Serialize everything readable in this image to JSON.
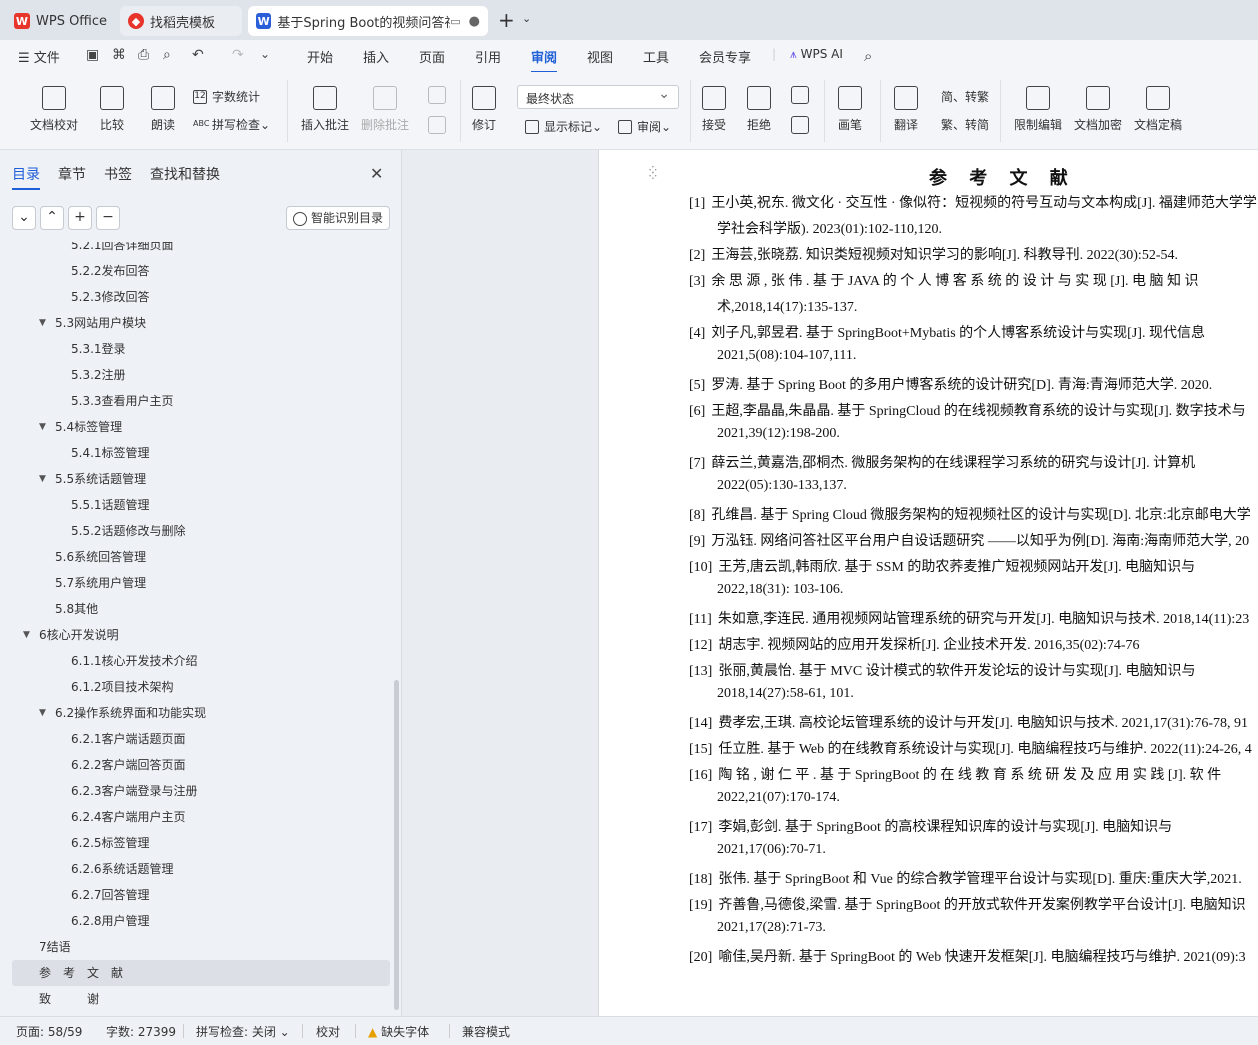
{
  "tabs": [
    {
      "label": "WPS Office",
      "icon": "wps-logo-icon"
    },
    {
      "label": "找稻壳模板",
      "icon": "docer-icon"
    },
    {
      "label": "基于Spring Boot的视频问答社",
      "icon": "word-doc-icon"
    }
  ],
  "menu": {
    "file": "文件",
    "items": [
      "开始",
      "插入",
      "页面",
      "引用",
      "审阅",
      "视图",
      "工具",
      "会员专享"
    ],
    "active": "审阅",
    "wps_ai": "WPS AI"
  },
  "ribbon": {
    "doc_proof": "文档校对",
    "compare": "比较",
    "read_aloud": "朗读",
    "word_count": "字数统计",
    "spell_check": "拼写检查",
    "insert_comment": "插入批注",
    "delete_comment": "删除批注",
    "revise": "修订",
    "status_value": "最终状态",
    "show_marks": "显示标记",
    "review": "审阅",
    "accept": "接受",
    "reject": "拒绝",
    "pen": "画笔",
    "translate": "翻译",
    "s2t": "简、转繁",
    "t2s": "繁、转简",
    "restrict_edit": "限制编辑",
    "doc_encrypt": "文档加密",
    "doc_finalize": "文档定稿"
  },
  "sidebar": {
    "tabs": [
      "目录",
      "章节",
      "书签",
      "查找和替换"
    ],
    "smart_toc": "智能识别目录",
    "items": [
      {
        "label": "5.2.1回答详细页面",
        "level": 3
      },
      {
        "label": "5.2.2发布回答",
        "level": 3
      },
      {
        "label": "5.2.3修改回答",
        "level": 3
      },
      {
        "label": "5.3网站用户模块",
        "level": 2,
        "arrow": true
      },
      {
        "label": "5.3.1登录",
        "level": 3
      },
      {
        "label": "5.3.2注册",
        "level": 3
      },
      {
        "label": "5.3.3查看用户主页",
        "level": 3
      },
      {
        "label": "5.4标签管理",
        "level": 2,
        "arrow": true
      },
      {
        "label": "5.4.1标签管理",
        "level": 3
      },
      {
        "label": "5.5系统话题管理",
        "level": 2,
        "arrow": true
      },
      {
        "label": "5.5.1话题管理",
        "level": 3
      },
      {
        "label": "5.5.2话题修改与删除",
        "level": 3
      },
      {
        "label": "5.6系统回答管理",
        "level": 2
      },
      {
        "label": "5.7系统用户管理",
        "level": 2
      },
      {
        "label": "5.8其他",
        "level": 2
      },
      {
        "label": "6核心开发说明",
        "level": 1,
        "arrow": true
      },
      {
        "label": "6.1.1核心开发技术介绍",
        "level": 3
      },
      {
        "label": "6.1.2项目技术架构",
        "level": 3
      },
      {
        "label": "6.2操作系统界面和功能实现",
        "level": 2,
        "arrow": true
      },
      {
        "label": "6.2.1客户端话题页面",
        "level": 3
      },
      {
        "label": "6.2.2客户端回答页面",
        "level": 3
      },
      {
        "label": "6.2.3客户端登录与注册",
        "level": 3
      },
      {
        "label": "6.2.4客户端用户主页",
        "level": 3
      },
      {
        "label": "6.2.5标签管理",
        "level": 3
      },
      {
        "label": "6.2.6系统话题管理",
        "level": 3
      },
      {
        "label": "6.2.7回答管理",
        "level": 3
      },
      {
        "label": "6.2.8用户管理",
        "level": 3
      },
      {
        "label": "7结语",
        "level": 1
      },
      {
        "label": "参　考　文　献",
        "level": 1,
        "selected": true
      },
      {
        "label": "致　　　谢",
        "level": 1
      }
    ]
  },
  "document": {
    "title": "参 考 文 献",
    "refs": [
      {
        "n": "[1]",
        "l1": "王小英,祝东. 微文化 · 交互性 · 像似符：短视频的符号互动与文本构成[J]. 福建师范大学学",
        "l2": "学社会科学版). 2023(01):102-110,120."
      },
      {
        "n": "[2]",
        "l1": "王海芸,张晓荔. 知识类短视频对知识学习的影响[J]. 科教导刊. 2022(30):52-54."
      },
      {
        "n": "[3]",
        "l1": "余 思 源 , 张 伟 .  基 于   JAVA  的 个 人 博 客 系 统 的 设 计 与 实 现 [J].  电 脑 知 识",
        "l2": "术,2018,14(17):135-137."
      },
      {
        "n": "[4]",
        "l1": "刘子凡,郭昱君. 基于 SpringBoot+Mybatis 的个人博客系统设计与实现[J]. 现代信息",
        "l2": "2021,5(08):104-107,111."
      },
      {
        "n": "[5]",
        "l1": "罗涛. 基于 Spring Boot 的多用户博客系统的设计研究[D]. 青海:青海师范大学. 2020."
      },
      {
        "n": "[6]",
        "l1": "王超,李晶晶,朱晶晶. 基于 SpringCloud 的在线视频教育系统的设计与实现[J]. 数字技术与",
        "l2": "2021,39(12):198-200."
      },
      {
        "n": "[7]",
        "l1": "薛云兰,黄嘉浩,邵桐杰. 微服务架构的在线课程学习系统的研究与设计[J]. 计算机",
        "l2": "2022(05):130-133,137."
      },
      {
        "n": "[8]",
        "l1": "孔维昌. 基于 Spring Cloud 微服务架构的短视频社区的设计与实现[D]. 北京:北京邮电大学"
      },
      {
        "n": "[9]",
        "l1": "万泓钰. 网络问答社区平台用户自设话题研究 ——以知乎为例[D]. 海南:海南师范大学, 20"
      },
      {
        "n": "[10]",
        "l1": "王芳,唐云凯,韩雨欣. 基于 SSM 的助农荞麦推广短视频网站开发[J]. 电脑知识与",
        "l2": "2022,18(31): 103-106."
      },
      {
        "n": "[11]",
        "l1": "朱如意,李连民. 通用视频网站管理系统的研究与开发[J]. 电脑知识与技术. 2018,14(11):23"
      },
      {
        "n": "[12]",
        "l1": "胡志宇. 视频网站的应用开发探析[J]. 企业技术开发. 2016,35(02):74-76"
      },
      {
        "n": "[13]",
        "l1": "张丽,黄晨怡. 基于 MVC 设计模式的软件开发论坛的设计与实现[J]. 电脑知识与",
        "l2": "2018,14(27):58-61, 101."
      },
      {
        "n": "[14]",
        "l1": "费孝宏,王琪. 高校论坛管理系统的设计与开发[J]. 电脑知识与技术. 2021,17(31):76-78, 91"
      },
      {
        "n": "[15]",
        "l1": "任立胜. 基于 Web 的在线教育系统设计与实现[J]. 电脑编程技巧与维护. 2022(11):24-26, 4"
      },
      {
        "n": "[16]",
        "l1": "陶 铭 , 谢 仁 平 .  基 于  SpringBoot 的 在 线 教 育 系 统 研 发 及 应 用 实 践 [J].  软 件",
        "l2": "2022,21(07):170-174."
      },
      {
        "n": "[17]",
        "l1": "李娟,彭剑. 基于 SpringBoot 的高校课程知识库的设计与实现[J]. 电脑知识与",
        "l2": "2021,17(06):70-71."
      },
      {
        "n": "[18]",
        "l1": "张伟. 基于 SpringBoot 和 Vue 的综合教学管理平台设计与实现[D]. 重庆:重庆大学,2021."
      },
      {
        "n": "[19]",
        "l1": "齐善鲁,马德俊,梁雪. 基于 SpringBoot 的开放式软件开发案例教学平台设计[J]. 电脑知识",
        "l2": "2021,17(28):71-73."
      },
      {
        "n": "[20]",
        "l1": "喻佳,吴丹新. 基于 SpringBoot 的 Web 快速开发框架[J]. 电脑编程技巧与维护. 2021(09):3"
      }
    ]
  },
  "status": {
    "page": "页面: 58/59",
    "words": "字数: 27399",
    "spell": "拼写检查: 关闭",
    "proof": "校对",
    "missing_font": "缺失字体",
    "compat": "兼容模式"
  },
  "colors": {
    "accent": "#1f5fd8",
    "wps_red": "#e8352c",
    "word_blue": "#2b5fd9"
  }
}
